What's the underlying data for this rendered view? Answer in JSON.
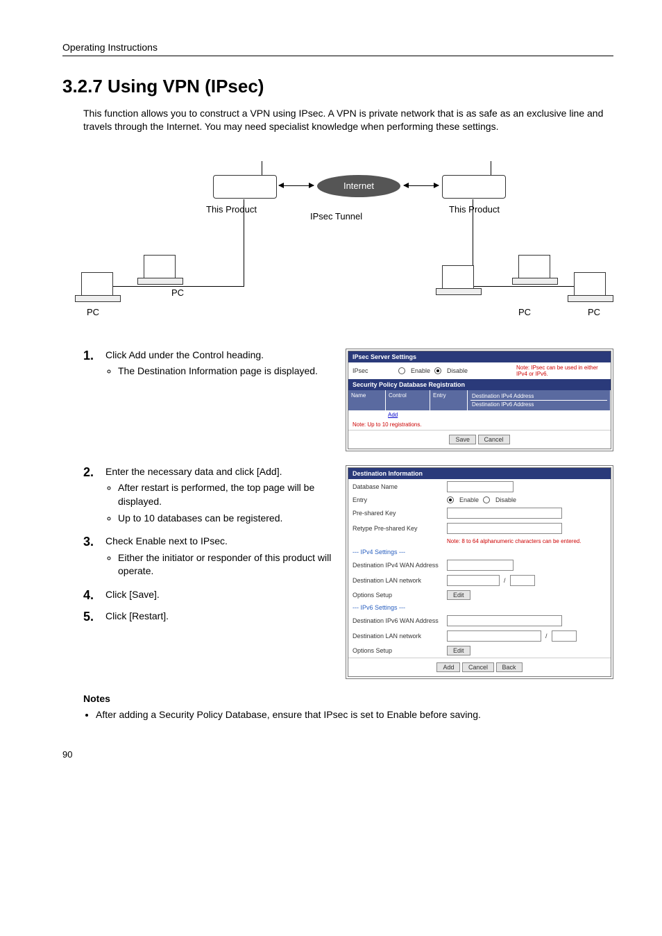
{
  "header": {
    "running": "Operating Instructions"
  },
  "title": "3.2.7    Using VPN (IPsec)",
  "intro": "This function allows you to construct a VPN using IPsec. A VPN is private network that is as safe as an exclusive line and travels through the Internet. You may need specialist knowledge when performing these settings.",
  "diagram": {
    "internet": "Internet",
    "this_product": "This Product",
    "ipsec_tunnel": "IPsec Tunnel",
    "pc": "PC"
  },
  "steps": [
    {
      "num": "1.",
      "text": "Click Add under the Control heading.",
      "subs": [
        "The Destination Information page is displayed."
      ]
    },
    {
      "num": "2.",
      "text": "Enter the necessary data and click [Add].",
      "subs": [
        "After restart is performed, the top page will be displayed.",
        "Up to 10 databases can be registered."
      ]
    },
    {
      "num": "3.",
      "text": "Check Enable next to IPsec.",
      "subs": [
        "Either the initiator or responder of this product will operate."
      ]
    },
    {
      "num": "4.",
      "text": "Click [Save].",
      "subs": []
    },
    {
      "num": "5.",
      "text": "Click [Restart].",
      "subs": []
    }
  ],
  "shot1": {
    "title1": "IPsec Server Settings",
    "ipsec_label": "IPsec",
    "enable": "Enable",
    "disable": "Disable",
    "note_top": "Note: IPsec can be used in either IPv4 or IPv6.",
    "title2": "Security Policy Database Registration",
    "col_name": "Name",
    "col_control": "Control",
    "col_entry": "Entry",
    "col_dest4": "Destination IPv4 Address",
    "col_dest6": "Destination IPv6 Address",
    "add_link": "Add",
    "note_bottom": "Note: Up to 10 registrations.",
    "save": "Save",
    "cancel": "Cancel"
  },
  "shot2": {
    "title": "Destination Information",
    "db_name": "Database Name",
    "entry": "Entry",
    "enable": "Enable",
    "disable": "Disable",
    "psk": "Pre-shared Key",
    "psk2": "Retype Pre-shared Key",
    "note_chars": "Note: 8 to 64 alphanumeric characters can be entered.",
    "ipv4_sect": "--- IPv4 Settings ---",
    "dest4wan": "Destination IPv4 WAN Address",
    "dest_lan": "Destination LAN network",
    "opt_setup": "Options Setup",
    "ipv6_sect": "--- IPv6 Settings ---",
    "dest6wan": "Destination IPv6 WAN Address",
    "edit": "Edit",
    "add": "Add",
    "cancel": "Cancel",
    "back": "Back"
  },
  "notes": {
    "heading": "Notes",
    "items": [
      "After adding a Security Policy Database, ensure that IPsec is set to Enable before saving."
    ]
  },
  "page_number": "90"
}
